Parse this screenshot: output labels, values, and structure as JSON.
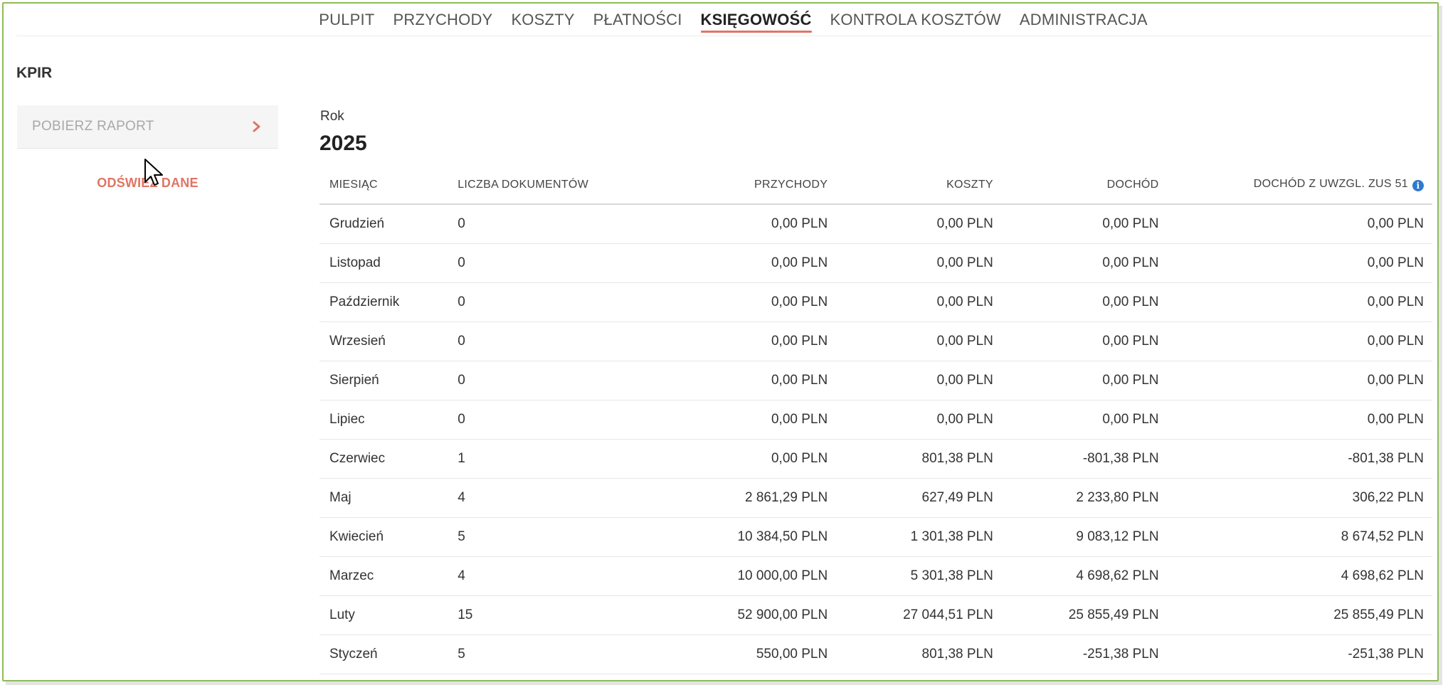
{
  "nav": {
    "items": [
      "PULPIT",
      "PRZYCHODY",
      "KOSZTY",
      "PŁATNOŚCI",
      "KSIĘGOWOŚĆ",
      "KONTROLA KOSZTÓW",
      "ADMINISTRACJA"
    ],
    "active": "KSIĘGOWOŚĆ"
  },
  "sidebar": {
    "title": "KPIR",
    "download_label": "POBIERZ RAPORT",
    "refresh_label": "ODŚWIEŻ DANE"
  },
  "year": {
    "label": "Rok",
    "value": "2025"
  },
  "table": {
    "headers": [
      "MIESIĄC",
      "LICZBA DOKUMENTÓW",
      "PRZYCHODY",
      "KOSZTY",
      "DOCHÓD",
      "DOCHÓD Z UWZGL. ZUS 51"
    ],
    "rows": [
      [
        "Grudzień",
        "0",
        "0,00 PLN",
        "0,00 PLN",
        "0,00 PLN",
        "0,00 PLN"
      ],
      [
        "Listopad",
        "0",
        "0,00 PLN",
        "0,00 PLN",
        "0,00 PLN",
        "0,00 PLN"
      ],
      [
        "Październik",
        "0",
        "0,00 PLN",
        "0,00 PLN",
        "0,00 PLN",
        "0,00 PLN"
      ],
      [
        "Wrzesień",
        "0",
        "0,00 PLN",
        "0,00 PLN",
        "0,00 PLN",
        "0,00 PLN"
      ],
      [
        "Sierpień",
        "0",
        "0,00 PLN",
        "0,00 PLN",
        "0,00 PLN",
        "0,00 PLN"
      ],
      [
        "Lipiec",
        "0",
        "0,00 PLN",
        "0,00 PLN",
        "0,00 PLN",
        "0,00 PLN"
      ],
      [
        "Czerwiec",
        "1",
        "0,00 PLN",
        "801,38 PLN",
        "-801,38 PLN",
        "-801,38 PLN"
      ],
      [
        "Maj",
        "4",
        "2 861,29 PLN",
        "627,49 PLN",
        "2 233,80 PLN",
        "306,22 PLN"
      ],
      [
        "Kwiecień",
        "5",
        "10 384,50 PLN",
        "1 301,38 PLN",
        "9 083,12 PLN",
        "8 674,52 PLN"
      ],
      [
        "Marzec",
        "4",
        "10 000,00 PLN",
        "5 301,38 PLN",
        "4 698,62 PLN",
        "4 698,62 PLN"
      ],
      [
        "Luty",
        "15",
        "52 900,00 PLN",
        "27 044,51 PLN",
        "25 855,49 PLN",
        "25 855,49 PLN"
      ],
      [
        "Styczeń",
        "5",
        "550,00 PLN",
        "801,38 PLN",
        "-251,38 PLN",
        "-251,38 PLN"
      ]
    ]
  },
  "icons": {
    "download_chevron": "chevron-right-icon",
    "info": "info-icon",
    "cursor": "mouse-pointer-icon"
  },
  "colors": {
    "accent": "#e07564",
    "info": "#2e7bcf",
    "frame": "#8fbc5a"
  }
}
